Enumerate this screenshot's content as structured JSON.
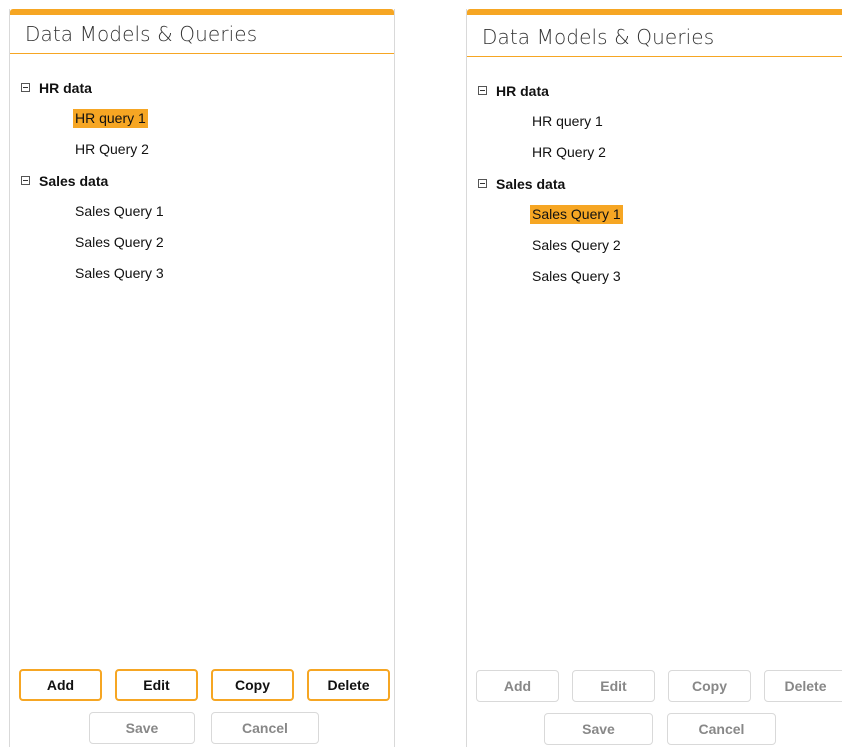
{
  "colors": {
    "accent": "#f6a623",
    "border": "#d9d9d9",
    "disabled_text": "#888888"
  },
  "panels": [
    {
      "title": "Data Models & Queries",
      "tree": [
        {
          "label": "HR data",
          "expanded": true,
          "children": [
            {
              "label": "HR query 1",
              "selected": true
            },
            {
              "label": "HR Query 2",
              "selected": false
            }
          ]
        },
        {
          "label": "Sales data",
          "expanded": true,
          "children": [
            {
              "label": "Sales Query 1",
              "selected": false
            },
            {
              "label": "Sales Query 2",
              "selected": false
            },
            {
              "label": "Sales Query 3",
              "selected": false
            }
          ]
        }
      ],
      "buttons": {
        "add": "Add",
        "edit": "Edit",
        "copy": "Copy",
        "delete": "Delete",
        "save": "Save",
        "cancel": "Cancel"
      },
      "buttons_enabled": {
        "add": true,
        "edit": true,
        "copy": true,
        "delete": true,
        "save": false,
        "cancel": false
      }
    },
    {
      "title": "Data Models & Queries",
      "tree": [
        {
          "label": "HR data",
          "expanded": true,
          "children": [
            {
              "label": "HR query 1",
              "selected": false
            },
            {
              "label": "HR Query 2",
              "selected": false
            }
          ]
        },
        {
          "label": "Sales data",
          "expanded": true,
          "children": [
            {
              "label": "Sales Query 1",
              "selected": true
            },
            {
              "label": "Sales Query 2",
              "selected": false
            },
            {
              "label": "Sales Query 3",
              "selected": false
            }
          ]
        }
      ],
      "buttons": {
        "add": "Add",
        "edit": "Edit",
        "copy": "Copy",
        "delete": "Delete",
        "save": "Save",
        "cancel": "Cancel"
      },
      "buttons_enabled": {
        "add": false,
        "edit": false,
        "copy": false,
        "delete": false,
        "save": false,
        "cancel": false
      }
    }
  ]
}
